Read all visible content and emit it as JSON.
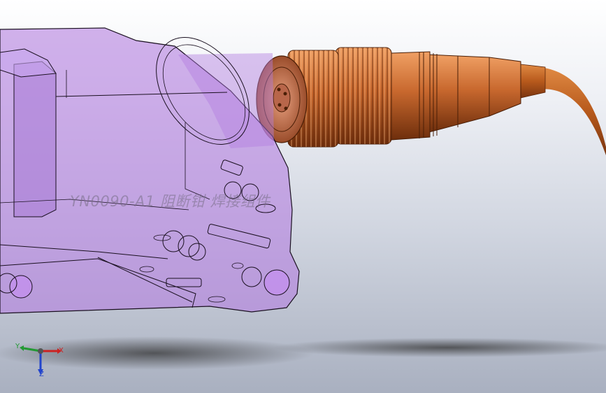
{
  "scene": {
    "watermark": "YN0090-A1 阻断钳 焊接组件",
    "triad": {
      "x_label": "X",
      "y_label": "Y",
      "z_label": "Z"
    }
  },
  "colors": {
    "housing": "#b47ee0",
    "connector": "#c8682e",
    "cable": "#b85a1c",
    "edges": "#1a1020",
    "background_top": "#ffffff",
    "background_bottom": "#a9b0c0"
  }
}
